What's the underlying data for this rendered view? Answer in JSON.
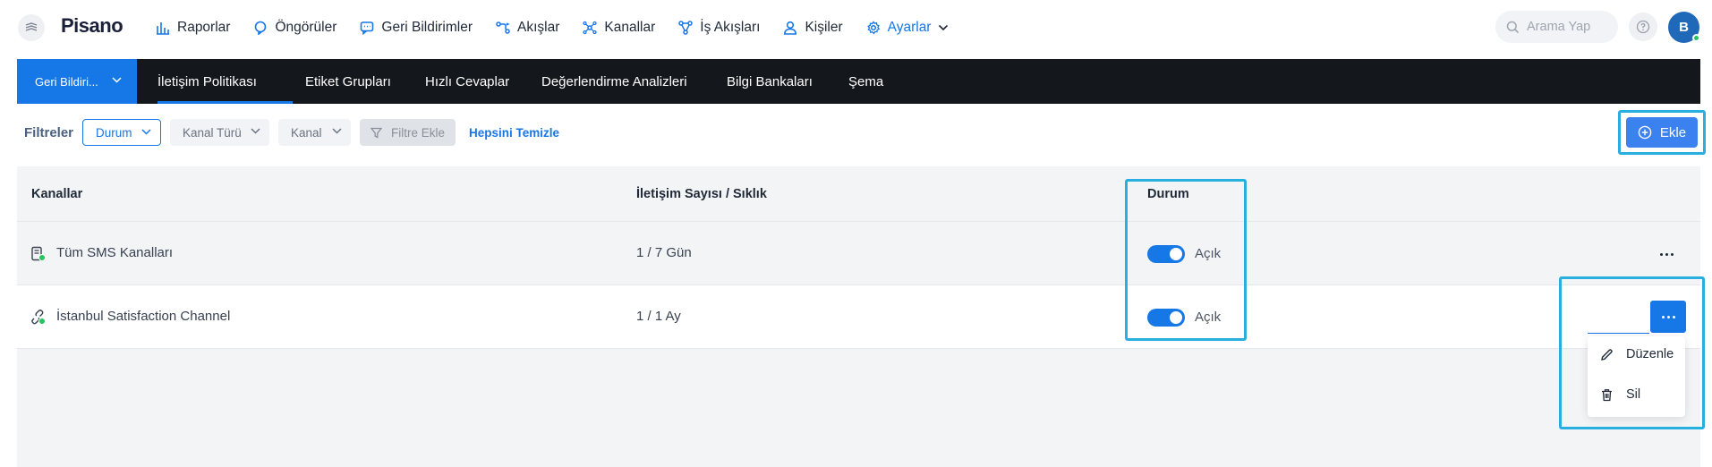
{
  "brand": {
    "logo": "Pisano"
  },
  "nav": {
    "items": [
      {
        "label": "Raporlar",
        "icon": "bar-chart-icon"
      },
      {
        "label": "Öngörüler",
        "icon": "insight-icon"
      },
      {
        "label": "Geri Bildirimler",
        "icon": "message-icon"
      },
      {
        "label": "Akışlar",
        "icon": "flow-icon"
      },
      {
        "label": "Kanallar",
        "icon": "channels-icon"
      },
      {
        "label": "İş Akışları",
        "icon": "workflow-icon"
      },
      {
        "label": "Kişiler",
        "icon": "user-icon"
      },
      {
        "label": "Ayarlar",
        "icon": "gear-icon"
      }
    ]
  },
  "search": {
    "placeholder": "Arama Yap"
  },
  "user": {
    "initial": "B"
  },
  "subnav": {
    "product": "Geri Bildiri...",
    "tabs": [
      {
        "label": "İletişim Politikası"
      },
      {
        "label": "Etiket Grupları"
      },
      {
        "label": "Hızlı Cevaplar"
      },
      {
        "label": "Değerlendirme Analizleri"
      },
      {
        "label": "Bilgi Bankaları"
      },
      {
        "label": "Şema"
      }
    ]
  },
  "filters": {
    "label": "Filtreler",
    "items": [
      {
        "label": "Durum"
      },
      {
        "label": "Kanal Türü"
      },
      {
        "label": "Kanal"
      }
    ],
    "add_label": "Filtre Ekle",
    "clear_label": "Hepsini Temizle"
  },
  "add_button": {
    "label": "Ekle"
  },
  "table": {
    "headers": [
      "Kanallar",
      "İletişim Sayısı / Sıklık",
      "Durum"
    ],
    "rows": [
      {
        "channel": "Tüm SMS Kanalları",
        "frequency": "1 / 7 Gün",
        "status": "Açık"
      },
      {
        "channel": "İstanbul Satisfaction Channel",
        "frequency": "1 / 1 Ay",
        "status": "Açık"
      }
    ]
  },
  "row_menu": {
    "items": [
      {
        "label": "Düzenle",
        "icon": "pencil-icon"
      },
      {
        "label": "Sil",
        "icon": "trash-icon"
      }
    ]
  },
  "colors": {
    "accent": "#1677e6",
    "highlight": "#29aee0",
    "subnav_bg": "#14171c"
  }
}
